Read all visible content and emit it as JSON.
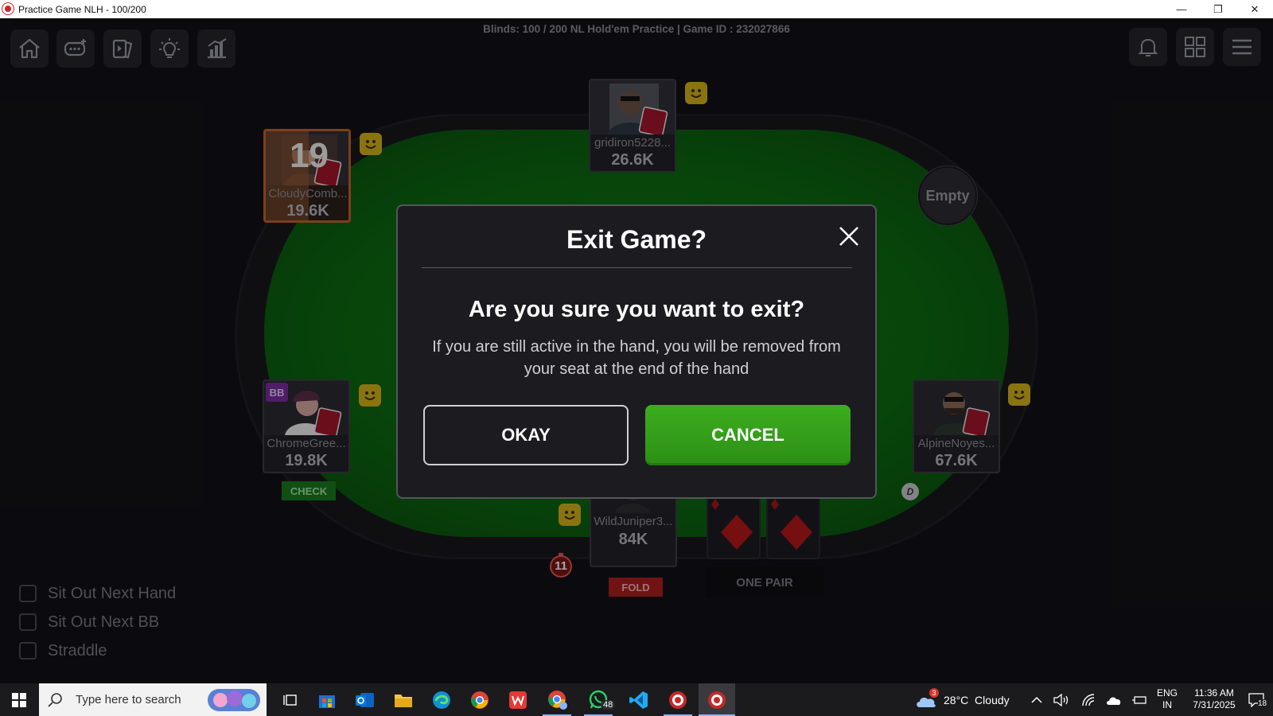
{
  "window": {
    "title": "Practice Game NLH - 100/200",
    "minimize_glyph": "—",
    "restore_glyph": "❐",
    "close_glyph": "✕"
  },
  "header": {
    "blinds_text": "Blinds: 100 / 200  NL Hold'em Practice | Game ID : 232027866"
  },
  "toolbar_left": [
    "home-icon",
    "chat-icon",
    "cards-icon",
    "lightbulb-icon",
    "stats-icon"
  ],
  "toolbar_right": [
    "bell-icon",
    "grid-icon",
    "menu-icon"
  ],
  "seats": [
    {
      "name": "gridiron5228...",
      "stack": "26.6K"
    },
    {
      "name": "CloudyComb...",
      "stack": "19.6K",
      "timer": "19",
      "active": true
    },
    {
      "name": "ChromeGree...",
      "stack": "19.8K",
      "badge": "BB",
      "action": "CHECK"
    },
    {
      "name": "AlpineNoyes...",
      "stack": "67.6K",
      "dealer": "D"
    },
    {
      "name": "WildJuniper3...",
      "stack": "84K",
      "action": "FOLD",
      "clock": "11"
    }
  ],
  "empty_seat": {
    "label": "Empty"
  },
  "hero": {
    "hand_rank": "ONE PAIR",
    "cards": [
      "diamond",
      "diamond"
    ]
  },
  "options": [
    {
      "label": "Sit Out Next Hand",
      "checked": false
    },
    {
      "label": "Sit Out Next BB",
      "checked": false
    },
    {
      "label": "Straddle",
      "checked": false
    }
  ],
  "dialog": {
    "title": "Exit Game?",
    "question": "Are you sure you want to exit?",
    "message": "If you are still active in the hand, you will be removed from your seat at the end of the hand",
    "okay_label": "OKAY",
    "cancel_label": "CANCEL"
  },
  "taskbar": {
    "search_placeholder": "Type here to search",
    "weather": "28°C  Cloudy",
    "weather_badge": "3",
    "whatsapp_badge": "48",
    "lang": "ENG",
    "region": "IN",
    "time": "11:36 AM",
    "date": "7/31/2025",
    "notifications": "18"
  },
  "colors": {
    "felt": "#0f7a14",
    "cancel_green": "#34a11a",
    "turn_orange": "#c0622a",
    "bb_purple": "#7a2ba0",
    "check_green": "#1a7a1e",
    "fold_red": "#b01e1e"
  }
}
